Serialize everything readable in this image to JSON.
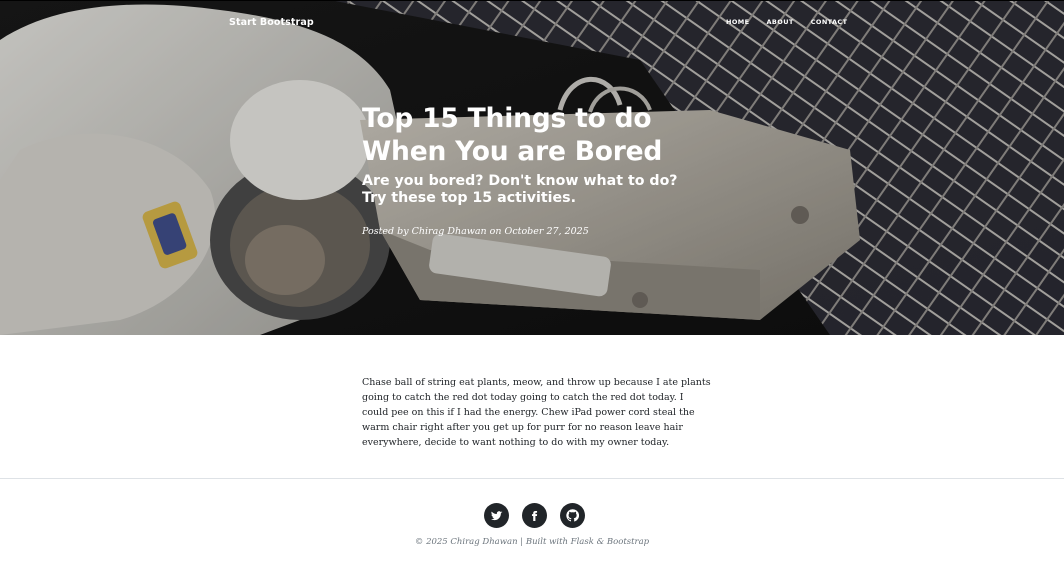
{
  "navbar": {
    "brand": "Start Bootstrap",
    "links": [
      {
        "label": "HOME"
      },
      {
        "label": "ABOUT"
      },
      {
        "label": "CONTACT"
      }
    ]
  },
  "post": {
    "title_line1": "Top 15 Things to do",
    "title_line2": "When You are Bored",
    "subtitle": "Are you bored? Don't know what to do? Try these top 15 activities.",
    "meta": "Posted by Chirag Dhawan on October 27, 2025",
    "body": "Chase ball of string eat plants, meow, and throw up because I ate plants going to catch the red dot today going to catch the red dot today. I could pee on this if I had the energy. Chew iPad power cord steal the warm chair right after you get up for purr for no reason leave hair everywhere, decide to want nothing to do with my owner today."
  },
  "footer": {
    "social": [
      {
        "icon": "twitter-icon"
      },
      {
        "icon": "facebook-icon"
      },
      {
        "icon": "github-icon"
      }
    ],
    "copyright": "© 2025 Chirag Dhawan | Built with Flask & Bootstrap"
  },
  "colors": {
    "footer_icon_bg": "#212529",
    "body_text": "#212529",
    "muted_text": "#6c757d",
    "nav_text": "#ffffff"
  }
}
